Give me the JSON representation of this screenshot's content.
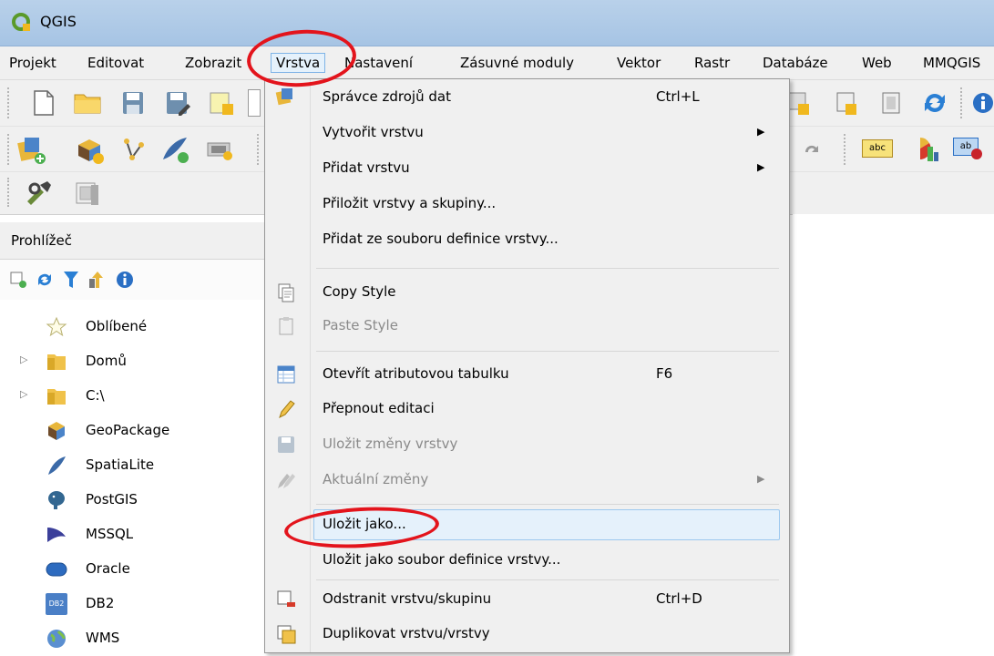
{
  "window": {
    "title": "QGIS"
  },
  "menubar": {
    "items": [
      {
        "label": "Projekt"
      },
      {
        "label": "Editovat"
      },
      {
        "label": "Zobrazit"
      },
      {
        "label": "Vrstva"
      },
      {
        "label": "Nastavení"
      },
      {
        "label": "Zásuvné moduly"
      },
      {
        "label": "Vektor"
      },
      {
        "label": "Rastr"
      },
      {
        "label": "Databáze"
      },
      {
        "label": "Web"
      },
      {
        "label": "MMQGIS"
      }
    ]
  },
  "browser": {
    "title": "Prohlížeč",
    "items": [
      {
        "label": "Oblíbené",
        "icon": "star-icon"
      },
      {
        "label": "Domů",
        "icon": "folder-icon"
      },
      {
        "label": "C:\\",
        "icon": "folder-icon"
      },
      {
        "label": "GeoPackage",
        "icon": "geopackage-icon"
      },
      {
        "label": "SpatiaLite",
        "icon": "feather-icon"
      },
      {
        "label": "PostGIS",
        "icon": "elephant-icon"
      },
      {
        "label": "MSSQL",
        "icon": "mssql-icon"
      },
      {
        "label": "Oracle",
        "icon": "oracle-icon"
      },
      {
        "label": "DB2",
        "icon": "db2-icon",
        "badge": "DB2"
      },
      {
        "label": "WMS",
        "icon": "globe-icon"
      }
    ]
  },
  "layer_menu": {
    "items": [
      {
        "label": "Správce zdrojů dat",
        "shortcut": "Ctrl+L"
      },
      {
        "label": "Vytvořit vrstvu",
        "submenu": "▶"
      },
      {
        "label": "Přidat vrstvu",
        "submenu": "▶"
      },
      {
        "label": "Přiložit vrstvy a skupiny..."
      },
      {
        "label": "Přidat ze souboru definice vrstvy..."
      },
      {
        "label": "Copy Style"
      },
      {
        "label": "Paste Style"
      },
      {
        "label": "Otevřít atributovou tabulku",
        "shortcut": "F6"
      },
      {
        "label": "Přepnout editaci"
      },
      {
        "label": "Uložit změny vrstvy"
      },
      {
        "label": "Aktuální změny",
        "submenu": "▶"
      },
      {
        "label": "Uložit jako..."
      },
      {
        "label": "Uložit jako soubor definice vrstvy..."
      },
      {
        "label": "Odstranit vrstvu/skupinu",
        "shortcut": "Ctrl+D"
      },
      {
        "label": "Duplikovat vrstvu/vrstvy"
      }
    ]
  },
  "toolbar": {
    "label_badge": "abc",
    "label_badge2": "ab"
  },
  "colors": {
    "highlight_ring": "#e3141c",
    "menu_hover": "#e5f1fb",
    "title_bar": "#b9d1ea"
  }
}
